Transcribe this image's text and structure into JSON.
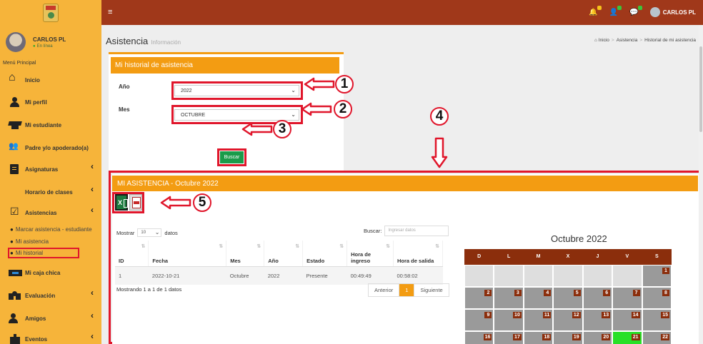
{
  "topbar": {
    "menu_toggle": "≡",
    "user_name": "CARLOS PL"
  },
  "sidebar": {
    "user_name": "CARLOS PL",
    "status": "En línea",
    "menu_title": "Menú Principal",
    "items": [
      {
        "label": "Inicio",
        "icon": "home-icon"
      },
      {
        "label": "Mi perfil",
        "icon": "user-icon"
      },
      {
        "label": "Mi estudiante",
        "icon": "graduation-cap-icon"
      },
      {
        "label": "Padre y/o apoderado(a)",
        "icon": "family-icon"
      },
      {
        "label": "Asignaturas",
        "icon": "book-icon"
      },
      {
        "label": "Horario de clases",
        "icon": "calendar-icon"
      },
      {
        "label": "Asistencias",
        "icon": "check-square-icon"
      },
      {
        "label": "Mi caja chica",
        "icon": "cash-icon"
      },
      {
        "label": "Evaluación",
        "icon": "evaluation-icon"
      },
      {
        "label": "Amigos",
        "icon": "friends-icon"
      },
      {
        "label": "Eventos",
        "icon": "gift-icon"
      }
    ],
    "sub_items": [
      {
        "label": "Marcar asistencia - estudiante"
      },
      {
        "label": "Mi asistencia"
      },
      {
        "label": "Mi historial"
      }
    ]
  },
  "page": {
    "title": "Asistencia",
    "subtitle": "Información",
    "breadcrumb": [
      "Inicio",
      "Asistencia",
      "Historial de mi asistencia"
    ]
  },
  "filter_card": {
    "title": "Mi historial de asistencia",
    "year_label": "Año",
    "year_value": "2022",
    "month_label": "Mes",
    "month_value": "OCTUBRE",
    "search_button": "Buscar"
  },
  "annotations": [
    "1",
    "2",
    "3",
    "4",
    "5"
  ],
  "attendance": {
    "title": "MI ASISTENCIA - Octubre 2022",
    "show_label": "Mostrar",
    "show_value": "10",
    "show_suffix": "datos",
    "search_label": "Buscar:",
    "search_placeholder": "Ingresar datos",
    "columns": [
      "ID",
      "Fecha",
      "Mes",
      "Año",
      "Estado",
      "Hora de ingreso",
      "Hora de salida"
    ],
    "rows": [
      [
        "1",
        "2022-10-21",
        "Octubre",
        "2022",
        "Presente",
        "00:49:49",
        "00:58:02"
      ]
    ],
    "info": "Mostrando 1 a 1 de 1 datos",
    "pager": {
      "prev": "Anterior",
      "current": "1",
      "next": "Siguiente"
    }
  },
  "calendar": {
    "title": "Octubre 2022",
    "weekdays": [
      "D",
      "L",
      "M",
      "X",
      "J",
      "V",
      "S"
    ],
    "weeks": [
      [
        "",
        "",
        "",
        "",
        "",
        "",
        "1"
      ],
      [
        "2",
        "3",
        "4",
        "5",
        "6",
        "7",
        "8"
      ],
      [
        "9",
        "10",
        "11",
        "12",
        "13",
        "14",
        "15"
      ],
      [
        "16",
        "17",
        "18",
        "19",
        "20",
        "21",
        "22"
      ]
    ],
    "highlight_day": "21",
    "highlight_color": "#28e028"
  },
  "colors": {
    "topbar": "#a0381a",
    "sidebar": "#f6b43a",
    "card_header": "#f39c12",
    "annotation": "#e0162b",
    "button_green": "#1a9b4a"
  }
}
